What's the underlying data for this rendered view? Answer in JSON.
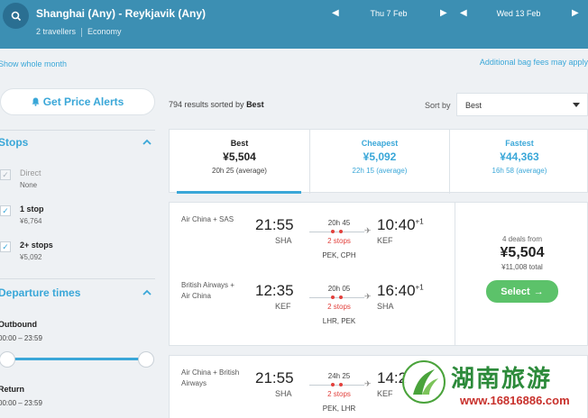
{
  "header": {
    "route": "Shanghai (Any) - Reykjavik (Any)",
    "travellers": "2 travellers",
    "cabin": "Economy",
    "depart_date": "Thu 7 Feb",
    "return_date": "Wed 13 Feb"
  },
  "links": {
    "show_month": "Show whole month",
    "bag_fees": "Additional bag fees may apply"
  },
  "sidebar": {
    "alert_button": "Get Price Alerts",
    "stops_title": "Stops",
    "stops": [
      {
        "label": "Direct",
        "price": "None",
        "checked": false
      },
      {
        "label": "1 stop",
        "price": "¥6,764",
        "checked": true
      },
      {
        "label": "2+ stops",
        "price": "¥5,092",
        "checked": true
      }
    ],
    "departure_title": "Departure times",
    "outbound_label": "Outbound",
    "outbound_range": "00:00 – 23:59",
    "return_label": "Return",
    "return_range": "00:00 – 23:59"
  },
  "results": {
    "count_prefix": "794 results sorted by",
    "sort_key": "Best",
    "sort_by_label": "Sort by",
    "sort_value": "Best"
  },
  "tabs": [
    {
      "label": "Best",
      "price": "¥5,504",
      "time": "20h 25 (average)"
    },
    {
      "label": "Cheapest",
      "price": "¥5,092",
      "time": "22h 15 (average)"
    },
    {
      "label": "Fastest",
      "price": "¥44,363",
      "time": "16h 58 (average)"
    }
  ],
  "cards": [
    {
      "legs": [
        {
          "airline": "Air China + SAS",
          "dep": "21:55",
          "dep_code": "SHA",
          "duration": "20h 45",
          "stops": "2 stops",
          "via": "PEK, CPH",
          "arr": "10:40",
          "arr_plus": "+1",
          "arr_code": "KEF"
        },
        {
          "airline": "British Airways + Air China",
          "dep": "12:35",
          "dep_code": "KEF",
          "duration": "20h 05",
          "stops": "2 stops",
          "via": "LHR, PEK",
          "arr": "16:40",
          "arr_plus": "+1",
          "arr_code": "SHA"
        }
      ],
      "deals": "4 deals from",
      "price": "¥5,504",
      "total": "¥11,008 total",
      "select": "Select"
    },
    {
      "legs": [
        {
          "airline": "Air China + British Airways",
          "dep": "21:55",
          "dep_code": "SHA",
          "duration": "24h 25",
          "stops": "2 stops",
          "via": "PEK, LHR",
          "arr": "14:2",
          "arr_plus": "",
          "arr_code": "KEF"
        }
      ]
    }
  ],
  "watermark": {
    "text": "湖南旅游",
    "url": "www.16816886.com"
  },
  "colors": {
    "header": "#3c8fb3",
    "accent": "#3aa7d8",
    "select": "#5cc26a",
    "stops": "#e2403c"
  }
}
